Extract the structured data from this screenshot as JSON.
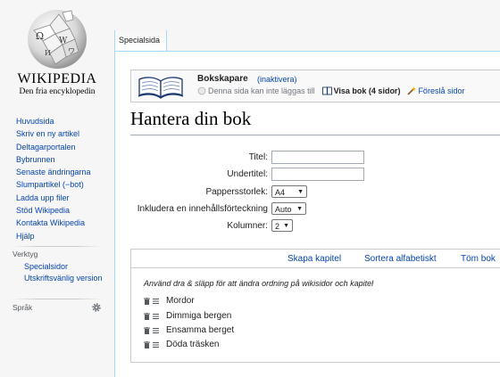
{
  "logo": {
    "wordmark": "WIKIPEDIA",
    "tagline": "Den fria encyklopedin"
  },
  "sidebar": {
    "nav": [
      "Huvudsida",
      "Skriv en ny artikel",
      "Deltagarportalen",
      "Bybrunnen",
      "Senaste ändringarna",
      "Slumpartikel (−bot)",
      "Ladda upp filer",
      "Stöd Wikipedia",
      "Kontakta Wikipedia",
      "Hjälp"
    ],
    "tools_heading": "Verktyg",
    "tools": [
      "Specialsidor",
      "Utskriftsvänlig version"
    ],
    "languages_heading": "Språk"
  },
  "tabs": {
    "special": "Specialsida"
  },
  "bookbox": {
    "title": "Bokskapare",
    "inactivate": "(inaktivera)",
    "cannot_add": "Denna sida kan inte läggas till",
    "show_book": "Visa bok (4 sidor)",
    "suggest": "Föreslå sidor"
  },
  "page": {
    "heading": "Hantera din bok"
  },
  "form": {
    "title_label": "Titel:",
    "title_value": "",
    "subtitle_label": "Undertitel:",
    "subtitle_value": "",
    "papersize_label": "Pappersstorlek:",
    "papersize_value": "A4",
    "toc_label": "Inkludera en innehållsförteckning",
    "toc_value": "Auto",
    "columns_label": "Kolumner:",
    "columns_value": "2"
  },
  "actions": {
    "create_chapter": "Skapa kapitel",
    "sort": "Sortera alfabetiskt",
    "empty": "Töm bok"
  },
  "chapters": {
    "hint": "Använd dra & släpp för att ändra ordning på wikisidor och kapitel",
    "items": [
      "Mordor",
      "Dimmiga bergen",
      "Ensamma berget",
      "Döda träsken"
    ]
  },
  "colors": {
    "link": "#0645ad",
    "border": "#a7d7f9"
  }
}
